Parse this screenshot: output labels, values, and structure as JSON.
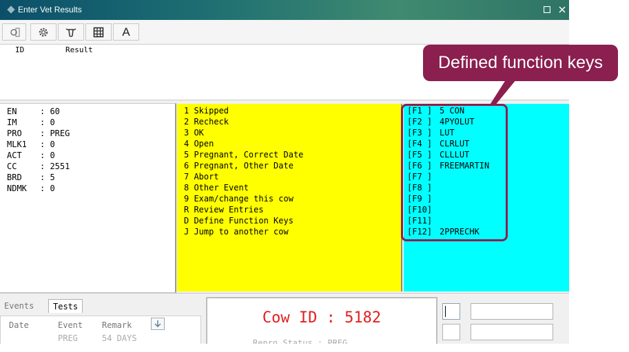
{
  "window": {
    "title": "Enter Vet Results"
  },
  "toolbar": {
    "text_button_label": "A"
  },
  "grid": {
    "col_id": "ID",
    "col_result": "Result"
  },
  "cow_info": [
    {
      "label": "EN",
      "value": "60"
    },
    {
      "label": "IM",
      "value": "0"
    },
    {
      "label": "PRO",
      "value": "PREG"
    },
    {
      "label": "MLK1",
      "value": "0"
    },
    {
      "label": "ACT",
      "value": "0"
    },
    {
      "label": "CC",
      "value": "2551"
    },
    {
      "label": "BRD",
      "value": "5"
    },
    {
      "label": "NDMK",
      "value": "0"
    }
  ],
  "options": [
    "1 Skipped",
    "2 Recheck",
    "3 OK",
    "4 Open",
    "5 Pregnant, Correct Date",
    "6 Pregnant, Other Date",
    "7 Abort",
    "8 Other Event",
    "9 Exam/change this cow",
    "R Review Entries",
    "D Define Function Keys",
    "J Jump to another cow"
  ],
  "function_keys": [
    {
      "key": "[F1 ]",
      "value": "5 CON"
    },
    {
      "key": "[F2 ]",
      "value": "4PYOLUT"
    },
    {
      "key": "[F3 ]",
      "value": "LUT"
    },
    {
      "key": "[F4 ]",
      "value": "CLRLUT"
    },
    {
      "key": "[F5 ]",
      "value": "CLLLUT"
    },
    {
      "key": "[F6 ]",
      "value": "FREEMARTIN"
    },
    {
      "key": "[F7 ]",
      "value": ""
    },
    {
      "key": "[F8 ]",
      "value": ""
    },
    {
      "key": "[F9 ]",
      "value": ""
    },
    {
      "key": "[F10]",
      "value": ""
    },
    {
      "key": "[F11]",
      "value": ""
    },
    {
      "key": "[F12]",
      "value": "2PPRECHK"
    }
  ],
  "bottom": {
    "tab_events": "Events",
    "tab_tests": "Tests",
    "col_date": "Date",
    "col_event": "Event",
    "col_remark": "Remark",
    "row_date": "",
    "row_event": "PREG",
    "row_remark": "54 DAYS",
    "cow_id_text": "Cow ID : 5182",
    "status_text": "Repro Status : PREG"
  },
  "callout": {
    "text": "Defined function keys"
  },
  "colors": {
    "options_panel": "#ffff00",
    "fkeys_panel": "#00ffff",
    "cow_id_text": "#e02020",
    "callout": "#8b1f4f"
  }
}
